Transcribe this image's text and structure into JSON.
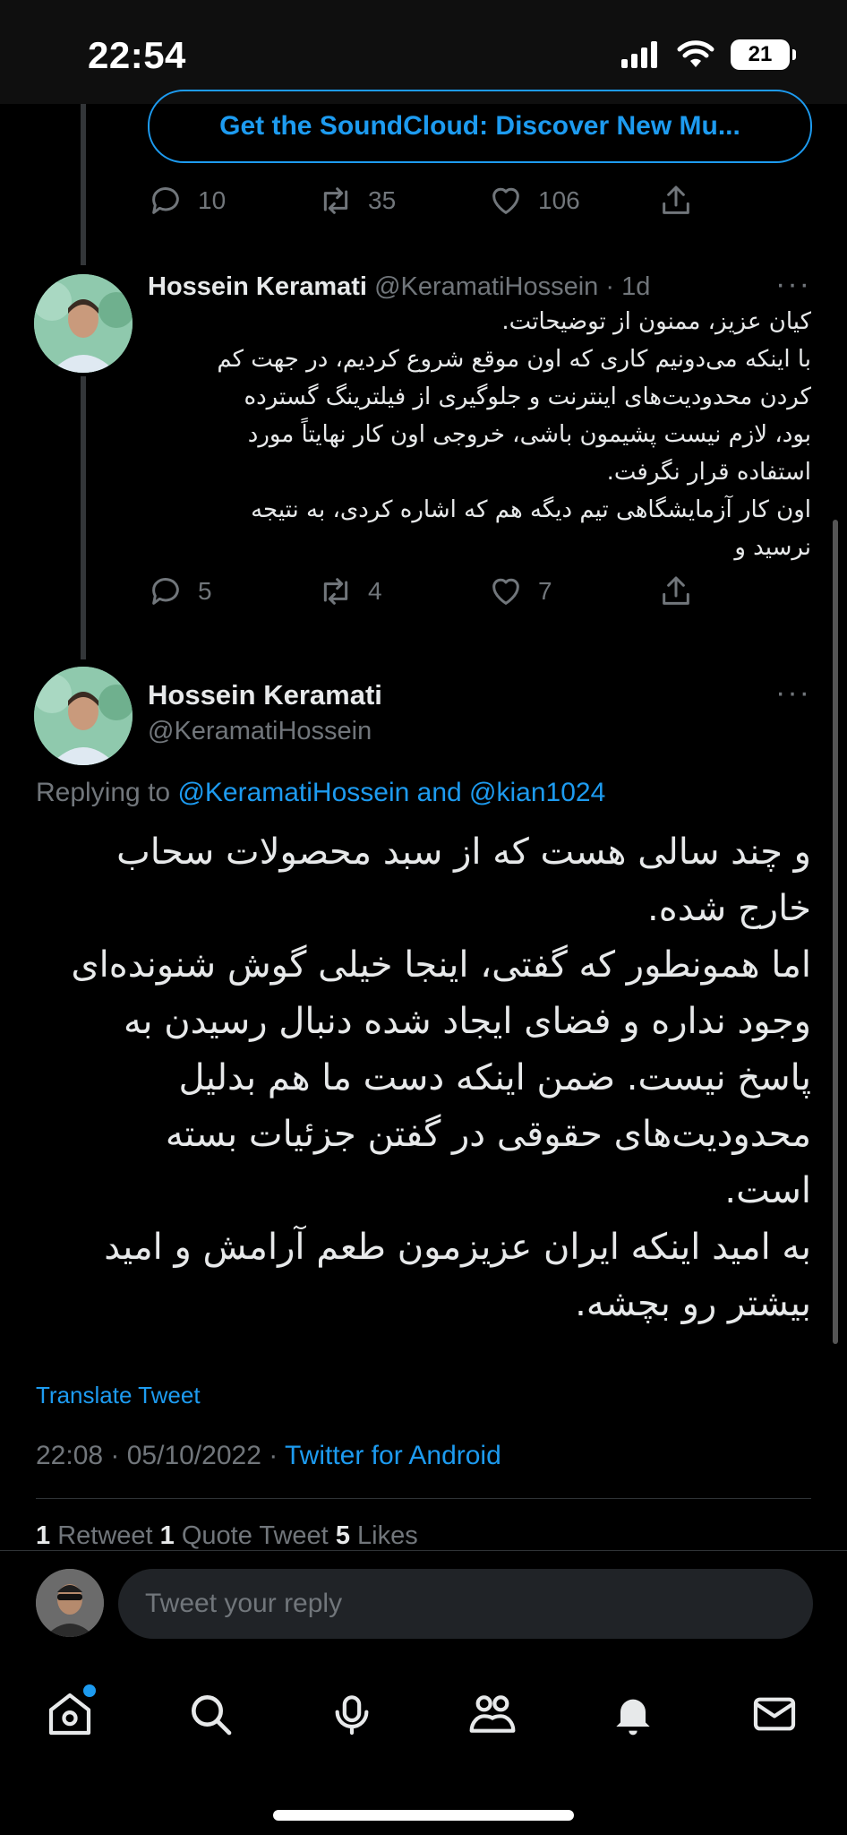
{
  "status_bar": {
    "time": "22:54",
    "battery": "21"
  },
  "link_card": {
    "title": "Get the SoundCloud: Discover New Mu..."
  },
  "first_tweet_actions": {
    "replies": "10",
    "retweets": "35",
    "likes": "106"
  },
  "reply_tweet": {
    "name": "Hossein Keramati",
    "handle_time": "@KeramatiHossein · 1d",
    "lines": [
      "کیان عزیز، ممنون از توضیحاتت.",
      "با اینکه می‌دونیم کاری که اون موقع شروع کردیم، در جهت کم",
      "کردن محدودیت‌های اینترنت و جلوگیری از فیلترینگ گسترده",
      "بود، لازم نیست پشیمون باشی، خروجی اون کار نهایتاً مورد",
      "استفاده قرار نگرفت.",
      "اون کار آزمایشگاهی تیم دیگه هم که اشاره کردی، به نتیجه",
      "نرسید و"
    ],
    "actions": {
      "replies": "5",
      "retweets": "4",
      "likes": "7"
    }
  },
  "main_tweet": {
    "name": "Hossein Keramati",
    "handle": "@KeramatiHossein",
    "replying_prefix": "Replying to ",
    "replying_to": "@KeramatiHossein and @kian1024",
    "lines": [
      "و چند سالی هست که از سبد محصولات سحاب",
      "خارج شده.",
      "اما همونطور که گفتی، اینجا خیلی گوش شنونده‌ای",
      "وجود نداره و فضای ایجاد شده دنبال رسیدن به",
      "پاسخ نیست. ضمن اینکه دست ما هم بدلیل",
      "محدودیت‌های حقوقی در گفتن جزئیات بسته",
      "است.",
      "به امید اینکه ایران عزیزمون طعم آرامش و امید",
      "بیشتر رو بچشه."
    ],
    "translate": "Translate Tweet",
    "timestamp": "22:08 · 05/10/2022 · ",
    "source": "Twitter for Android",
    "stats": {
      "retweets_count": "1",
      "retweets_label": " Retweet  ",
      "quotes_count": "1",
      "quotes_label": " Quote Tweet  ",
      "likes_count": "5",
      "likes_label": " Likes"
    }
  },
  "composer": {
    "placeholder": "Tweet your reply"
  },
  "nav": [
    "home-icon",
    "search-icon",
    "spaces-icon",
    "communities-icon",
    "notifications-icon",
    "messages-icon"
  ],
  "colors": {
    "accent": "#1d9bf0",
    "muted": "#71767b",
    "background": "#000000"
  }
}
